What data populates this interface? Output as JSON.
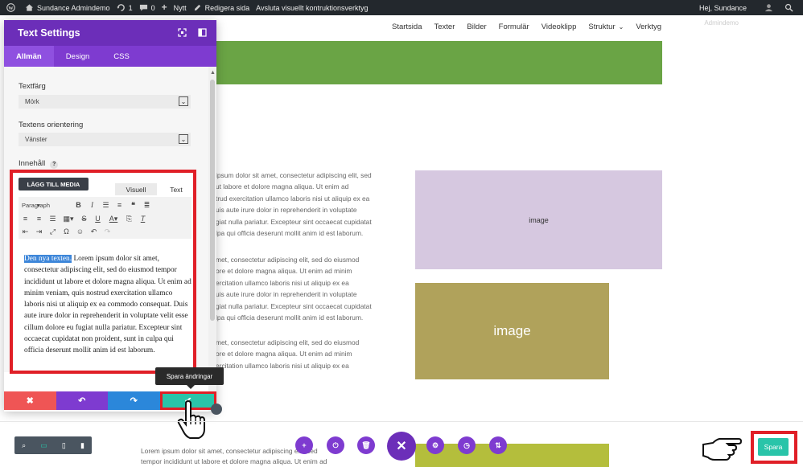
{
  "adminbar": {
    "site_name": "Sundance Admindemo",
    "updates_count": "1",
    "comments_count": "0",
    "new_label": "Nytt",
    "edit_label": "Redigera sida",
    "exit_builder_label": "Avsluta visuellt kontruktionsverktyg",
    "greeting": "Hej, Sundance"
  },
  "greeting_sub": "Admindemo",
  "site_nav": {
    "items": [
      "Startsida",
      "Texter",
      "Bilder",
      "Formulär",
      "Videoklipp",
      "Struktur",
      "Verktyg"
    ]
  },
  "panel": {
    "title": "Text Settings",
    "tabs": [
      "Allmän",
      "Design",
      "CSS"
    ],
    "text_color_label": "Textfärg",
    "text_color_value": "Mörk",
    "orientation_label": "Textens orientering",
    "orientation_value": "Vänster",
    "content_label": "Innehåll",
    "help_glyph": "?"
  },
  "editor": {
    "add_media_label": "LÄGG TILL MEDIA",
    "tab_visual": "Visuell",
    "tab_text": "Text",
    "format_select": "Paragraph",
    "highlighted_text": "Den nya texten.",
    "body_text": " Lorem ipsum dolor sit amet, consectetur adipiscing elit, sed do eiusmod tempor incididunt ut labore et dolore magna aliqua. Ut enim ad minim veniam, quis nostrud exercitation ullamco laboris nisi ut aliquip ex ea commodo consequat. Duis aute irure dolor in reprehenderit in voluptate velit esse cillum dolore eu fugiat nulla pariatur. Excepteur sint occaecat cupidatat non proident, sunt in culpa qui officia deserunt mollit anim id est laborum."
  },
  "tooltip": "Spara ändringar",
  "page_text": {
    "block1": [
      "ipsum dolor sit amet, consectetur adipiscing elit, sed",
      "ut labore et dolore magna aliqua. Ut enim ad",
      "trud exercitation ullamco laboris nisi ut aliquip ex ea",
      "uis aute irure dolor in reprehenderit in voluptate",
      "giat nulla pariatur. Excepteur sint occaecat cupidatat",
      "lpa qui officia deserunt mollit anim id est laborum."
    ],
    "block2": [
      "met, consectetur adipiscing elit, sed do eiusmod",
      "ore et dolore magna aliqua. Ut enim ad minim",
      "ercitation ullamco laboris nisi ut aliquip ex ea",
      "uis aute irure dolor in reprehenderit in voluptate",
      "giat nulla pariatur. Excepteur sint occaecat cupidatat",
      "lpa qui officia deserunt mollit anim id est laborum."
    ],
    "block3": [
      "met, consectetur adipiscing elit, sed do eiusmod",
      "ore et dolore magna aliqua. Ut enim ad minim",
      "ercitation ullamco laboris nisi ut aliquip ex ea"
    ],
    "bottom": [
      "Lorem ipsum dolor sit amet, consectetur adipiscing elit, sed",
      "tempor incididunt ut labore et dolore magna aliqua. Ut enim ad"
    ]
  },
  "images": {
    "img1_label": "image",
    "img2_label": "image"
  },
  "save_button_label": "Spara",
  "colors": {
    "admin_bar": "#23282d",
    "panel_header": "#6c2eb9",
    "accent_green": "#29c4a9",
    "highlight_red": "#e01f27",
    "green_band": "#6aa445"
  }
}
